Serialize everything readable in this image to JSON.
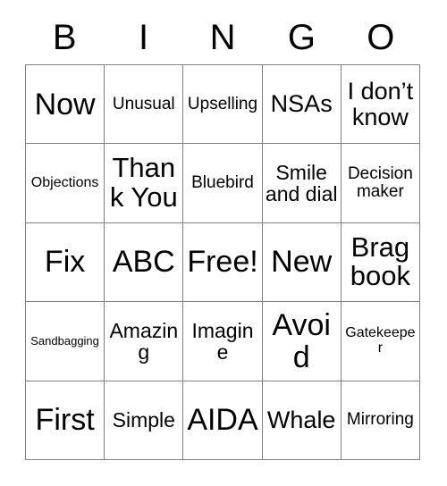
{
  "card": {
    "title": "BINGO",
    "header_letters": [
      "B",
      "I",
      "N",
      "G",
      "O"
    ],
    "grid_size": "5x5",
    "colors": {
      "background": "#ffffff",
      "cell_background": "#ffffff",
      "border": "#808080",
      "text": "#000000"
    },
    "rows": [
      [
        {
          "text": "Now",
          "size": "fs-xxl"
        },
        {
          "text": "Unusual",
          "size": "fs-sm"
        },
        {
          "text": "Upselling",
          "size": "fs-sm"
        },
        {
          "text": "NSAs",
          "size": "fs-lg"
        },
        {
          "text": "I don’t know",
          "size": "fs-lg"
        }
      ],
      [
        {
          "text": "Objections",
          "size": "fs-xs"
        },
        {
          "text": "Thank You",
          "size": "fs-xl"
        },
        {
          "text": "Bluebird",
          "size": "fs-sm"
        },
        {
          "text": "Smile and dial",
          "size": "fs-md"
        },
        {
          "text": "Decision maker",
          "size": "fs-sm"
        }
      ],
      [
        {
          "text": "Fix",
          "size": "fs-xxl"
        },
        {
          "text": "ABC",
          "size": "fs-xxl"
        },
        {
          "text": "Free!",
          "size": "fs-xxl"
        },
        {
          "text": "New",
          "size": "fs-xxl"
        },
        {
          "text": "Brag book",
          "size": "fs-xl"
        }
      ],
      [
        {
          "text": "Sandbagging",
          "size": "fs-xxs"
        },
        {
          "text": "Amazing",
          "size": "fs-md"
        },
        {
          "text": "Imagine",
          "size": "fs-md"
        },
        {
          "text": "Avoid",
          "size": "fs-xxl"
        },
        {
          "text": "Gatekeeper",
          "size": "fs-xs"
        }
      ],
      [
        {
          "text": "First",
          "size": "fs-xxl"
        },
        {
          "text": "Simple",
          "size": "fs-md"
        },
        {
          "text": "AIDA",
          "size": "fs-xxl"
        },
        {
          "text": "Whale",
          "size": "fs-lg"
        },
        {
          "text": "Mirroring",
          "size": "fs-sm"
        }
      ]
    ]
  }
}
